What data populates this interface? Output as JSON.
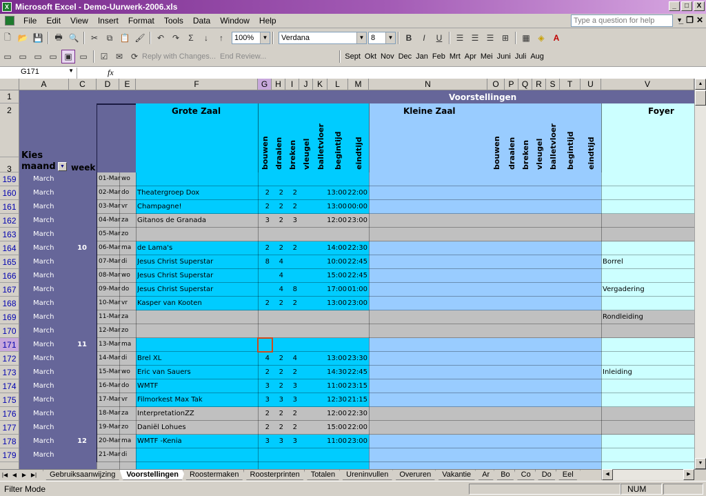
{
  "window": {
    "title": "Microsoft Excel - Demo-Uurwerk-2006.xls",
    "min": "_",
    "max": "□",
    "close": "X"
  },
  "menu": [
    "File",
    "Edit",
    "View",
    "Insert",
    "Format",
    "Tools",
    "Data",
    "Window",
    "Help"
  ],
  "help_placeholder": "Type a question for help",
  "toolbar": {
    "zoom": "100%",
    "font": "Verdana",
    "size": "8",
    "reply": "Reply with Changes...",
    "end_review": "End Review...",
    "months": [
      "Sept",
      "Okt",
      "Nov",
      "Dec",
      "Jan",
      "Feb",
      "Mrt",
      "Apr",
      "Mei",
      "Juni",
      "Juli",
      "Aug"
    ]
  },
  "formula": {
    "namebox": "G171",
    "fx": "fx",
    "content": ""
  },
  "columns": [
    "A",
    "C",
    "D",
    "E",
    "F",
    "G",
    "H",
    "I",
    "J",
    "K",
    "L",
    "M",
    "N",
    "O",
    "P",
    "Q",
    "R",
    "S",
    "T",
    "U",
    "V"
  ],
  "headers": {
    "title": "Voorstellingen",
    "zone1": "Grote Zaal",
    "zone2": "Kleine Zaal",
    "zone3": "Foyer",
    "kies": "Kies",
    "maand": "maand",
    "week": "week",
    "vertical": [
      "bouwen",
      "draaien",
      "breken",
      "vleugel",
      "balletvloer",
      "begintijd",
      "eindtijd"
    ]
  },
  "top_rows": [
    "1",
    "2",
    "3"
  ],
  "rows": [
    {
      "n": "159",
      "month": "March",
      "week": "",
      "date": "01-Mar",
      "day": "wo",
      "name": "",
      "g": "",
      "h": "",
      "i": "",
      "l": "",
      "m": "",
      "v": "",
      "kind": "b"
    },
    {
      "n": "160",
      "month": "March",
      "week": "",
      "date": "02-Mar",
      "day": "do",
      "name": "Theatergroep Dox",
      "g": "2",
      "h": "2",
      "i": "2",
      "l": "13:00",
      "m": "22:00",
      "v": "",
      "kind": "b"
    },
    {
      "n": "161",
      "month": "March",
      "week": "",
      "date": "03-Mar",
      "day": "vr",
      "name": "Champagne!",
      "g": "2",
      "h": "2",
      "i": "2",
      "l": "13:00",
      "m": "00:00",
      "v": "",
      "kind": "b"
    },
    {
      "n": "162",
      "month": "March",
      "week": "",
      "date": "04-Mar",
      "day": "za",
      "name": "Gitanos de Granada",
      "g": "3",
      "h": "2",
      "i": "3",
      "l": "12:00",
      "m": "23:00",
      "v": "",
      "kind": "g"
    },
    {
      "n": "163",
      "month": "March",
      "week": "",
      "date": "05-Mar",
      "day": "zo",
      "name": "",
      "g": "",
      "h": "",
      "i": "",
      "l": "",
      "m": "",
      "v": "",
      "kind": "g"
    },
    {
      "n": "164",
      "month": "March",
      "week": "10",
      "date": "06-Mar",
      "day": "ma",
      "name": "de Lama's",
      "g": "2",
      "h": "2",
      "i": "2",
      "l": "14:00",
      "m": "22:30",
      "v": "",
      "kind": "b"
    },
    {
      "n": "165",
      "month": "March",
      "week": "",
      "date": "07-Mar",
      "day": "di",
      "name": "Jesus Christ Superstar",
      "g": "8",
      "h": "4",
      "i": "",
      "l": "10:00",
      "m": "22:45",
      "v": "Borrel",
      "kind": "b"
    },
    {
      "n": "166",
      "month": "March",
      "week": "",
      "date": "08-Mar",
      "day": "wo",
      "name": "Jesus Christ Superstar",
      "g": "",
      "h": "4",
      "i": "",
      "l": "15:00",
      "m": "22:45",
      "v": "",
      "kind": "b"
    },
    {
      "n": "167",
      "month": "March",
      "week": "",
      "date": "09-Mar",
      "day": "do",
      "name": "Jesus Christ Superstar",
      "g": "",
      "h": "4",
      "i": "8",
      "l": "17:00",
      "m": "01:00",
      "v": "Vergadering",
      "kind": "b"
    },
    {
      "n": "168",
      "month": "March",
      "week": "",
      "date": "10-Mar",
      "day": "vr",
      "name": "Kasper van Kooten",
      "g": "2",
      "h": "2",
      "i": "2",
      "l": "13:00",
      "m": "23:00",
      "v": "",
      "kind": "b"
    },
    {
      "n": "169",
      "month": "March",
      "week": "",
      "date": "11-Mar",
      "day": "za",
      "name": "",
      "g": "",
      "h": "",
      "i": "",
      "l": "",
      "m": "",
      "v": "Rondleiding",
      "kind": "g"
    },
    {
      "n": "170",
      "month": "March",
      "week": "",
      "date": "12-Mar",
      "day": "zo",
      "name": "",
      "g": "",
      "h": "",
      "i": "",
      "l": "",
      "m": "",
      "v": "",
      "kind": "g"
    },
    {
      "n": "171",
      "month": "March",
      "week": "11",
      "date": "13-Mar",
      "day": "ma",
      "name": "",
      "g": "",
      "h": "",
      "i": "",
      "l": "",
      "m": "",
      "v": "",
      "kind": "b"
    },
    {
      "n": "172",
      "month": "March",
      "week": "",
      "date": "14-Mar",
      "day": "di",
      "name": "Brel XL",
      "g": "4",
      "h": "2",
      "i": "4",
      "l": "13:00",
      "m": "23:30",
      "v": "",
      "kind": "b"
    },
    {
      "n": "173",
      "month": "March",
      "week": "",
      "date": "15-Mar",
      "day": "wo",
      "name": "Eric van Sauers",
      "g": "2",
      "h": "2",
      "i": "2",
      "l": "14:30",
      "m": "22:45",
      "v": "Inleiding",
      "kind": "b"
    },
    {
      "n": "174",
      "month": "March",
      "week": "",
      "date": "16-Mar",
      "day": "do",
      "name": "WMTF",
      "g": "3",
      "h": "2",
      "i": "3",
      "l": "11:00",
      "m": "23:15",
      "v": "",
      "kind": "b"
    },
    {
      "n": "175",
      "month": "March",
      "week": "",
      "date": "17-Mar",
      "day": "vr",
      "name": "Filmorkest Max Tak",
      "g": "3",
      "h": "3",
      "i": "3",
      "l": "12:30",
      "m": "21:15",
      "v": "",
      "kind": "b"
    },
    {
      "n": "176",
      "month": "March",
      "week": "",
      "date": "18-Mar",
      "day": "za",
      "name": "InterpretationZZ",
      "g": "2",
      "h": "2",
      "i": "2",
      "l": "12:00",
      "m": "22:30",
      "v": "",
      "kind": "g"
    },
    {
      "n": "177",
      "month": "March",
      "week": "",
      "date": "19-Mar",
      "day": "zo",
      "name": "Daniël Lohues",
      "g": "2",
      "h": "2",
      "i": "2",
      "l": "15:00",
      "m": "22:00",
      "v": "",
      "kind": "g"
    },
    {
      "n": "178",
      "month": "March",
      "week": "12",
      "date": "20-Mar",
      "day": "ma",
      "name": "WMTF -Kenia",
      "g": "3",
      "h": "3",
      "i": "3",
      "l": "11:00",
      "m": "23:00",
      "v": "",
      "kind": "b"
    },
    {
      "n": "179",
      "month": "March",
      "week": "",
      "date": "21-Mar",
      "day": "di",
      "name": "",
      "g": "",
      "h": "",
      "i": "",
      "l": "",
      "m": "",
      "v": "",
      "kind": "b"
    }
  ],
  "tabs": [
    "Gebruiksaanwijzing",
    "Voorstellingen",
    "Roostermaken",
    "Roosterprinten",
    "Totalen",
    "Ureninvullen",
    "Overuren",
    "Vakantie",
    "Ar",
    "Bo",
    "Co",
    "Do",
    "Eel"
  ],
  "active_tab": "Voorstellingen",
  "status": {
    "mode": "Filter Mode",
    "num": "NUM"
  },
  "colors": {
    "cyan": "#00ccff",
    "lightblue": "#99ccff",
    "paleblue": "#ccffff",
    "purple": "#666699",
    "grey": "#c0c0c0"
  }
}
